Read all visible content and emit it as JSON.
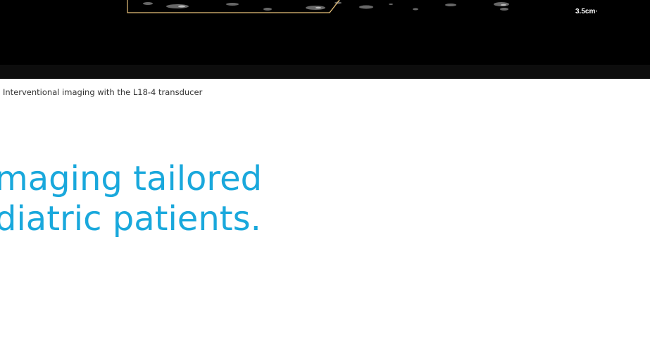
{
  "figure": {
    "depth_label": "3.5cm·",
    "caption": "Interventional imaging with the L18-4 transducer"
  },
  "headline": {
    "line1": "maging tailored",
    "line2": "diatric patients."
  },
  "colors": {
    "headline": "#19a8dc",
    "guide_line": "#e6c07a",
    "image_background": "#000000"
  }
}
